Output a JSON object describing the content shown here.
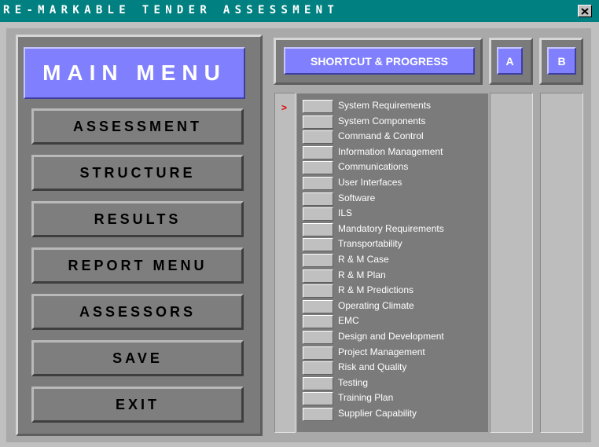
{
  "window": {
    "title": "RE-MARKABLE TENDER ASSESSMENT",
    "close_glyph": "✕"
  },
  "menu": {
    "main_label": "MAIN MENU",
    "buttons": [
      "ASSESSMENT",
      "STRUCTURE",
      "RESULTS",
      "REPORT MENU",
      "ASSESSORS",
      "SAVE",
      "EXIT"
    ]
  },
  "progress": {
    "title": "SHORTCUT & PROGRESS",
    "col_a": "A",
    "col_b": "B",
    "current_marker": ">",
    "items": [
      "System Requirements",
      "System Components",
      "Command & Control",
      "Information Management",
      "Communications",
      "User Interfaces",
      "Software",
      "ILS",
      "Mandatory Requirements",
      "Transportability",
      "R & M Case",
      "R & M Plan",
      "R & M Predictions",
      "Operating Climate",
      "EMC",
      "Design and Development",
      "Project Management",
      "Risk and Quality",
      "Testing",
      "Training Plan",
      "Supplier Capability"
    ]
  },
  "colors": {
    "titlebar": "#008080",
    "accent": "#8080ff",
    "marker": "#e00000"
  }
}
